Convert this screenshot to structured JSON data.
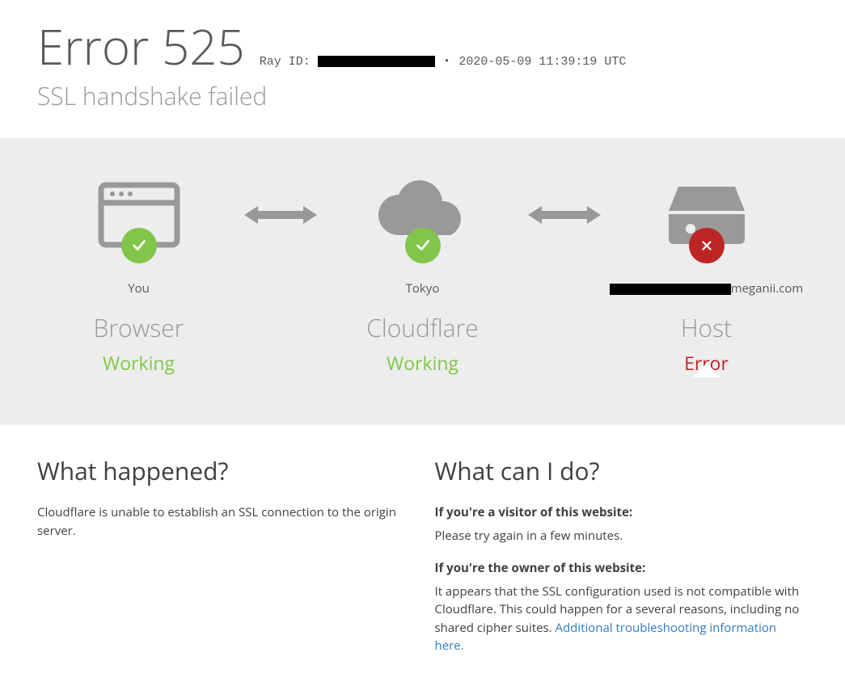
{
  "header": {
    "error_code": "Error 525",
    "ray_label": "Ray ID: ",
    "timestamp": "2020-05-09 11:39:19 UTC",
    "subtitle": "SSL handshake failed"
  },
  "status": {
    "browser": {
      "loc": "You",
      "desc": "Browser",
      "status": "Working"
    },
    "cloudflare": {
      "loc": "Tokyo",
      "desc": "Cloudflare",
      "status": "Working"
    },
    "host": {
      "domain_suffix": "meganii.com",
      "desc": "Host",
      "status": "Error"
    }
  },
  "what_happened": {
    "title": "What happened?",
    "body": "Cloudflare is unable to establish an SSL connection to the origin server."
  },
  "what_can_i_do": {
    "title": "What can I do?",
    "visitor_h": "If you're a visitor of this website:",
    "visitor_p": "Please try again in a few minutes.",
    "owner_h": "If you're the owner of this website:",
    "owner_p": "It appears that the SSL configuration used is not compatible with Cloudflare. This could happen for a several reasons, including no shared cipher suites. ",
    "owner_link": "Additional troubleshooting information here."
  }
}
